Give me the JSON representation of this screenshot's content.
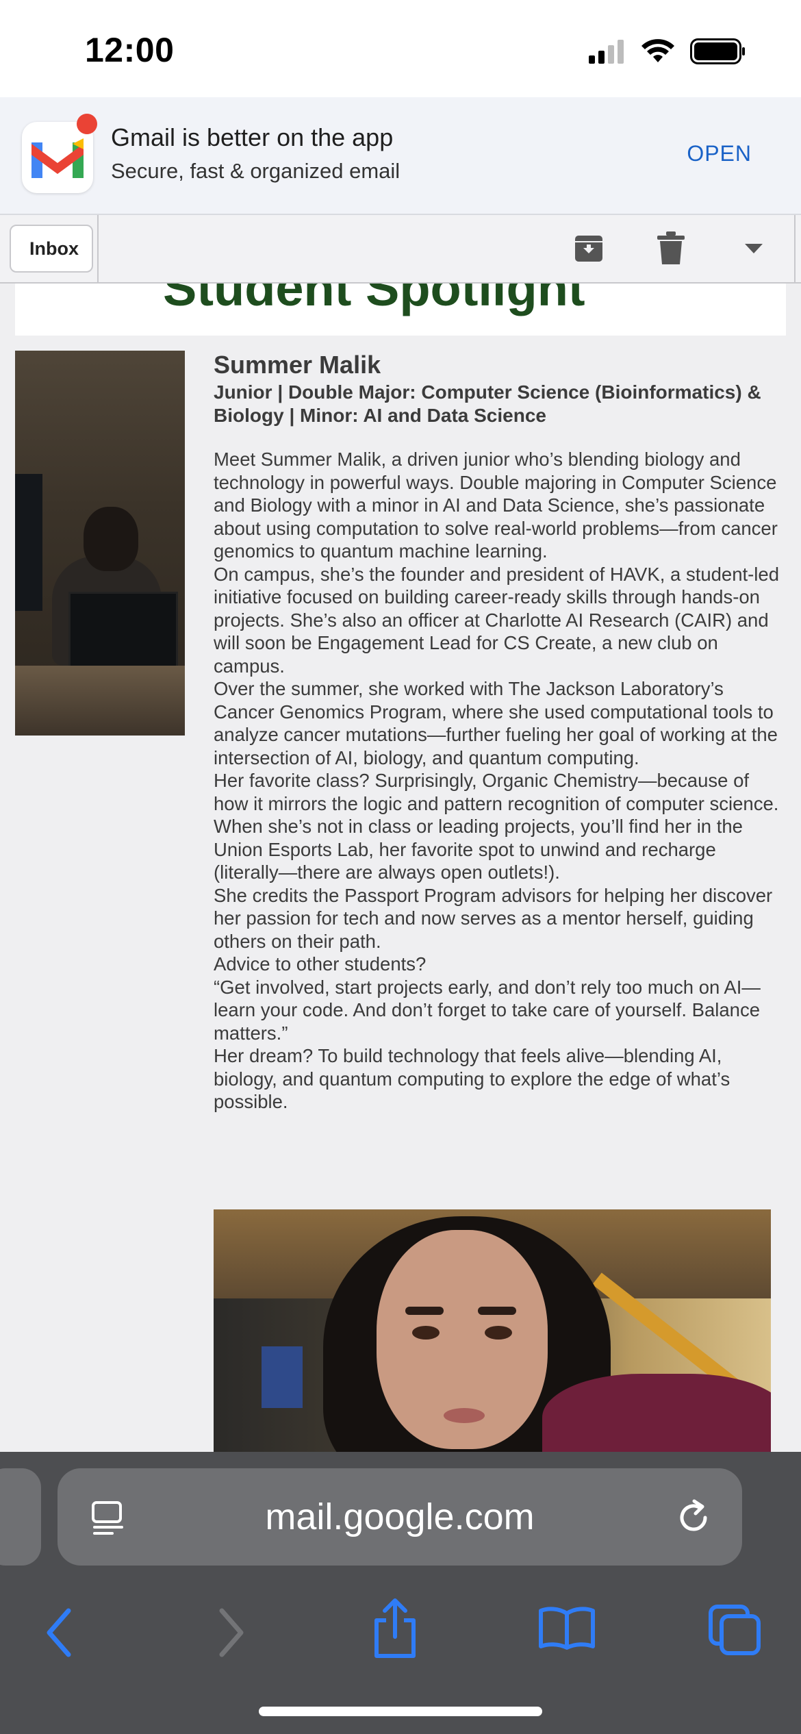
{
  "status_bar": {
    "time": "12:00"
  },
  "app_banner": {
    "title": "Gmail is better on the app",
    "subtitle": "Secure, fast & organized email",
    "open_label": "OPEN"
  },
  "toolbar": {
    "inbox_label": "Inbox"
  },
  "email": {
    "spotlight_title": "Student Spotlight",
    "name": "Summer Malik",
    "subheading": "Junior | Double Major: Computer Science (Bioinformatics) & Biology | Minor: AI and Data Science",
    "paragraphs": [
      "Meet Summer Malik, a driven junior who’s blending biology and technology in powerful ways. Double majoring in Computer Science and Biology with a minor in AI and Data Science, she’s passionate about using computation to solve real-world problems—from cancer genomics to quantum machine learning.",
      "On campus, she’s the founder and president of HAVK, a student-led initiative focused on building career-ready skills through hands-on projects. She’s also an officer at Charlotte AI Research (CAIR) and will soon be Engagement Lead for CS Create, a new club on campus.",
      "Over the summer, she worked with The Jackson Laboratory’s Cancer Genomics Program, where she used computational tools to analyze cancer mutations—further fueling her goal of working at the intersection of AI, biology, and quantum computing.",
      "Her favorite class? Surprisingly, Organic Chemistry—because of how it mirrors the logic and pattern recognition of computer science.",
      "When she’s not in class or leading projects, you’ll find her in the Union Esports Lab, her favorite spot to unwind and recharge (literally—there are always open outlets!).",
      "She credits the Passport Program advisors for helping her discover her passion for tech and now serves as a mentor herself, guiding others on their path.",
      "Advice to other students?",
      "“Get involved, start projects early, and don’t rely too much on AI—learn your code. And don’t forget to take care of yourself. Balance matters.”",
      "Her dream? To build technology that feels alive—blending AI, biology, and quantum computing to explore the edge of what’s possible."
    ]
  },
  "browser": {
    "url": "mail.google.com"
  },
  "colors": {
    "gmail_red": "#ea4335",
    "gmail_blue": "#4285f4",
    "gmail_green": "#34a853",
    "gmail_yellow": "#fbbc04",
    "open_blue": "#1a62c7",
    "spotlight_green": "#1e4d1e",
    "safari_blue": "#2f7cf6"
  },
  "icons": [
    "signal-icon",
    "wifi-icon",
    "battery-icon",
    "gmail-logo-icon",
    "archive-icon",
    "trash-icon",
    "dropdown-arrow-icon",
    "reader-icon",
    "reload-icon",
    "back-arrow-icon",
    "forward-arrow-icon",
    "share-icon",
    "bookmarks-icon",
    "tabs-icon"
  ]
}
